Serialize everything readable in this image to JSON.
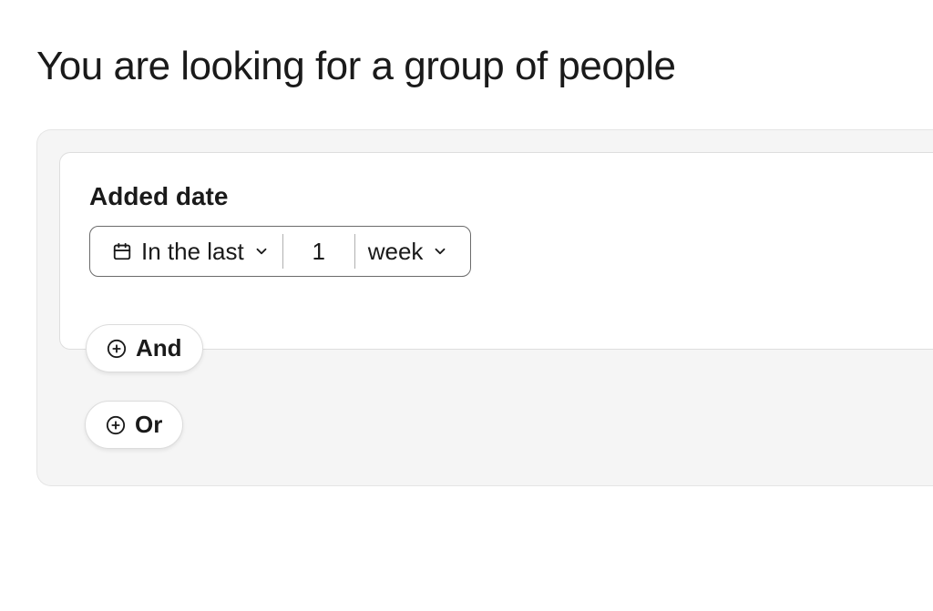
{
  "title": "You are looking for a group of people",
  "filter": {
    "label": "Added date",
    "operator": "In the last",
    "value": "1",
    "unit": "week"
  },
  "buttons": {
    "and": "And",
    "or": "Or"
  }
}
